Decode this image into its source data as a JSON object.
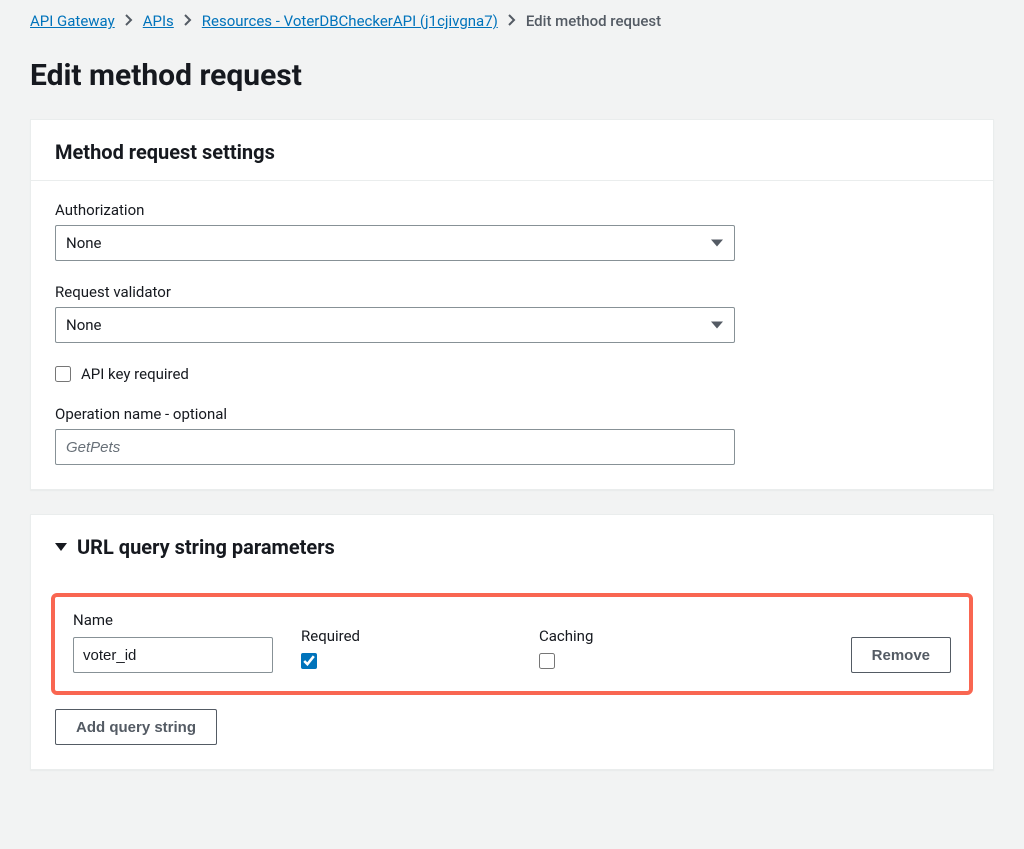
{
  "breadcrumb": {
    "items": [
      {
        "label": "API Gateway",
        "link": true
      },
      {
        "label": "APIs",
        "link": true
      },
      {
        "label": "Resources - VoterDBCheckerAPI (j1cjivgna7)",
        "link": true
      },
      {
        "label": "Edit method request",
        "link": false
      }
    ]
  },
  "page": {
    "title": "Edit method request"
  },
  "settings": {
    "heading": "Method request settings",
    "authorization": {
      "label": "Authorization",
      "value": "None"
    },
    "validator": {
      "label": "Request validator",
      "value": "None"
    },
    "api_key": {
      "label": "API key required",
      "checked": false
    },
    "operation_name": {
      "label": "Operation name - optional",
      "placeholder": "GetPets",
      "value": ""
    }
  },
  "query_params": {
    "heading": "URL query string parameters",
    "columns": {
      "name": "Name",
      "required": "Required",
      "caching": "Caching"
    },
    "rows": [
      {
        "name": "voter_id",
        "required": true,
        "caching": false
      }
    ],
    "remove_label": "Remove",
    "add_label": "Add query string"
  }
}
